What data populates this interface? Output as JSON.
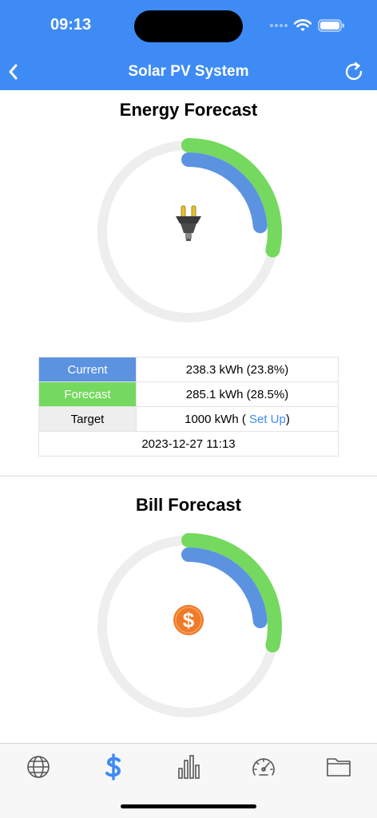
{
  "status_bar": {
    "time": "09:13"
  },
  "nav": {
    "title": "Solar PV System"
  },
  "energy": {
    "title": "Energy Forecast",
    "current_fraction": 0.238,
    "forecast_fraction": 0.285,
    "rows": {
      "current_label": "Current",
      "current_value": "238.3 kWh (23.8%)",
      "forecast_label": "Forecast",
      "forecast_value": "285.1 kWh (28.5%)",
      "target_label": "Target",
      "target_prefix": "1000 kWh ( ",
      "target_link": "Set Up",
      "target_suffix": ")",
      "timestamp": "2023-12-27 11:13"
    }
  },
  "bill": {
    "title": "Bill Forecast",
    "current_fraction": 0.238,
    "forecast_fraction": 0.285
  },
  "tabs": [
    {
      "icon": "globe-icon"
    },
    {
      "icon": "dollar-icon",
      "active": true
    },
    {
      "icon": "bar-chart-icon"
    },
    {
      "icon": "speedometer-icon"
    },
    {
      "icon": "folder-icon"
    }
  ],
  "colors": {
    "accent": "#3e8bf5",
    "current": "#5b93e1",
    "forecast": "#74d95e",
    "track": "#eeeeee",
    "inactive_icon": "#555555"
  }
}
